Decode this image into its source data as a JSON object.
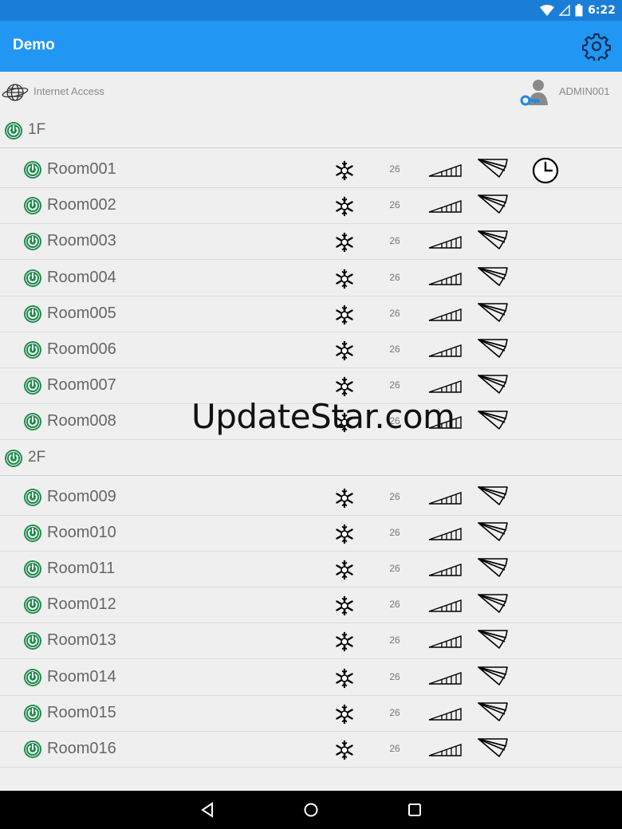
{
  "status": {
    "time": "6:22"
  },
  "app": {
    "title": "Demo"
  },
  "info": {
    "internet_label": "Internet Access",
    "user": "ADMIN001"
  },
  "floors": [
    {
      "label": "1F",
      "rooms": [
        {
          "name": "Room001",
          "temp": "26",
          "timer": true
        },
        {
          "name": "Room002",
          "temp": "26"
        },
        {
          "name": "Room003",
          "temp": "26"
        },
        {
          "name": "Room004",
          "temp": "26"
        },
        {
          "name": "Room005",
          "temp": "26"
        },
        {
          "name": "Room006",
          "temp": "26"
        },
        {
          "name": "Room007",
          "temp": "26"
        },
        {
          "name": "Room008",
          "temp": "26"
        }
      ]
    },
    {
      "label": "2F",
      "rooms": [
        {
          "name": "Room009",
          "temp": "26"
        },
        {
          "name": "Room010",
          "temp": "26"
        },
        {
          "name": "Room011",
          "temp": "26"
        },
        {
          "name": "Room012",
          "temp": "26"
        },
        {
          "name": "Room013",
          "temp": "26"
        },
        {
          "name": "Room014",
          "temp": "26"
        },
        {
          "name": "Room015",
          "temp": "26"
        },
        {
          "name": "Room016",
          "temp": "26"
        }
      ]
    }
  ],
  "watermark": "UpdateStar.com",
  "icons": {
    "power": "power-icon",
    "mode": "snowflake-cool-icon",
    "fan": "fan-speed-bars-icon",
    "swing": "louver-swing-icon",
    "timer": "clock-timer-icon",
    "settings": "gear-icon",
    "internet": "globe-icon",
    "admin": "user-key-icon"
  },
  "colors": {
    "appbar": "#2196f3",
    "statusbar": "#1a7ed6",
    "power_green": "#1f8a4c",
    "background": "#efefef"
  }
}
